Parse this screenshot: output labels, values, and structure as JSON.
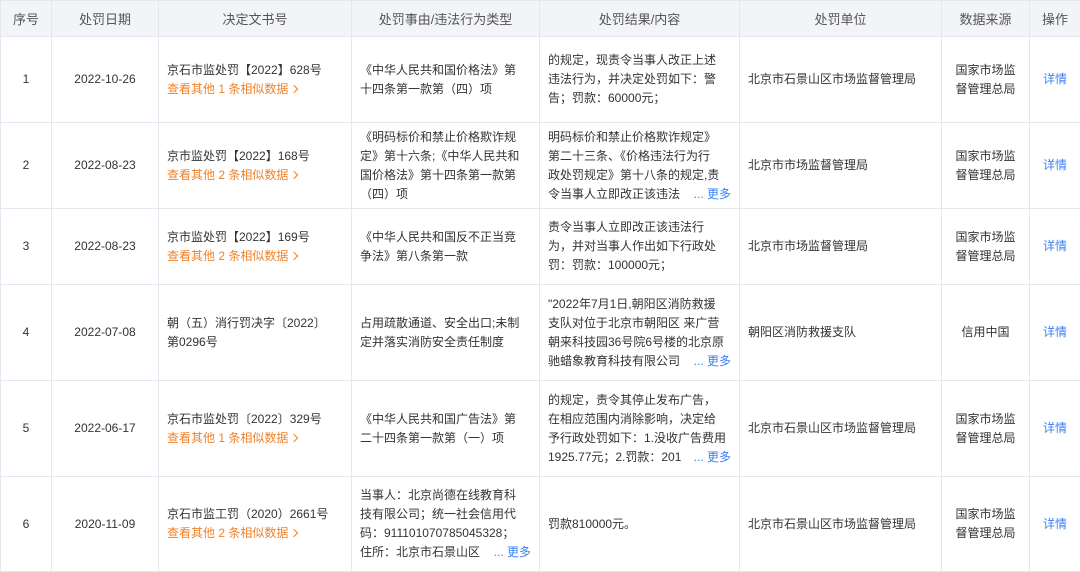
{
  "headers": [
    "序号",
    "处罚日期",
    "决定文书号",
    "处罚事由/违法行为类型",
    "处罚结果/内容",
    "处罚单位",
    "数据来源",
    "操作"
  ],
  "rows": [
    {
      "no": "1",
      "date": "2022-10-26",
      "doc": "京石市监处罚【2022】628号",
      "similar": "查看其他 1 条相似数据",
      "reason": [
        "《中华人民共和国价格法》第",
        "十四条第一款第（四）项"
      ],
      "result": [
        "的规定，现责令当事人改正上述",
        "违法行为，并决定处罚如下：警",
        "告；罚款：60000元；"
      ],
      "result_more": "",
      "unit": "北京市石景山区市场监督管理局",
      "source": [
        "国家市场监",
        "督管理总局"
      ],
      "action": "详情"
    },
    {
      "no": "2",
      "date": "2022-08-23",
      "doc": "京市监处罚【2022】168号",
      "similar": "查看其他 2 条相似数据",
      "reason": [
        "《明码标价和禁止价格欺诈规",
        "定》第十六条;《中华人民共和",
        "国价格法》第十四条第一款第",
        "（四）项"
      ],
      "result": [
        "明码标价和禁止价格欺诈规定》",
        "第二十三条、《价格违法行为行",
        "政处罚规定》第十八条的规定,责",
        "令当事人立即改正该违法"
      ],
      "result_more": "... 更多",
      "unit": "北京市市场监督管理局",
      "source": [
        "国家市场监",
        "督管理总局"
      ],
      "action": "详情"
    },
    {
      "no": "3",
      "date": "2022-08-23",
      "doc": "京市监处罚【2022】169号",
      "similar": "查看其他 2 条相似数据",
      "reason": [
        "《中华人民共和国反不正当竞",
        "争法》第八条第一款"
      ],
      "result": [
        "责令当事人立即改正该违法行",
        "为，并对当事人作出如下行政处",
        "罚：罚款：100000元；"
      ],
      "result_more": "",
      "unit": "北京市市场监督管理局",
      "source": [
        "国家市场监",
        "督管理总局"
      ],
      "action": "详情"
    },
    {
      "no": "4",
      "date": "2022-07-08",
      "doc_lines": [
        "朝（五）消行罚决字〔2022〕",
        "第0296号"
      ],
      "similar": "",
      "reason": [
        "占用疏散通道、安全出口;未制",
        "定并落实消防安全责任制度"
      ],
      "result": [
        "\"2022年7月1日,朝阳区消防救援",
        "支队对位于北京市朝阳区 来广营",
        "朝来科技园36号院6号楼的北京原",
        "驰蜡象教育科技有限公司"
      ],
      "result_more": "... 更多",
      "unit": "朝阳区消防救援支队",
      "source": [
        "信用中国"
      ],
      "action": "详情"
    },
    {
      "no": "5",
      "date": "2022-06-17",
      "doc": "京石市监处罚〔2022〕329号",
      "similar": "查看其他 1 条相似数据",
      "reason": [
        "《中华人民共和国广告法》第",
        "二十四条第一款第（一）项"
      ],
      "result": [
        "的规定，责令其停止发布广告，",
        "在相应范围内消除影响，决定给",
        "予行政处罚如下：1.没收广告费用",
        "1925.77元；2.罚款：201"
      ],
      "result_more": "... 更多",
      "unit": "北京市石景山区市场监督管理局",
      "source": [
        "国家市场监",
        "督管理总局"
      ],
      "action": "详情"
    },
    {
      "no": "6",
      "date": "2020-11-09",
      "doc": "京石市监工罚（2020）2661号",
      "similar": "查看其他 2 条相似数据",
      "reason": [
        "当事人：北京尚德在线教育科",
        "技有限公司；统一社会信用代",
        "码：911101070785045328；",
        "住所：北京市石景山区"
      ],
      "reason_more": "... 更多",
      "result": [
        "罚款810000元。"
      ],
      "result_more": "",
      "unit": "北京市石景山区市场监督管理局",
      "source": [
        "国家市场监",
        "督管理总局"
      ],
      "action": "详情"
    }
  ],
  "colors": {
    "header_bg": "#f2f4f7",
    "border": "#e4e7ed",
    "link_blue": "#3a82f7",
    "link_orange": "#f0822a"
  },
  "icons": {
    "similar_arrow": "chevron-right-icon"
  }
}
